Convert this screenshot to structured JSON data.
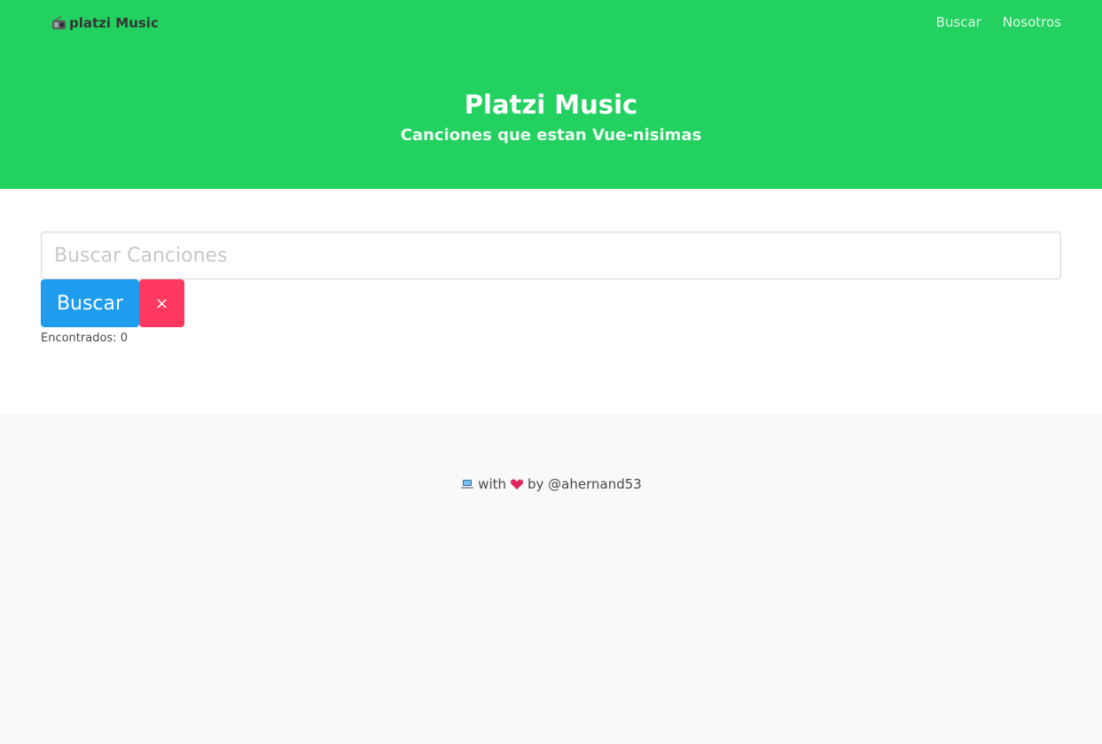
{
  "header": {
    "brand": {
      "icon": "radio-icon",
      "label": "platzi Music"
    },
    "nav": [
      {
        "label": "Buscar"
      },
      {
        "label": "Nosotros"
      }
    ],
    "title": "Platzi Music",
    "subtitle": "Canciones que estan Vue-nisimas"
  },
  "search": {
    "value": "",
    "placeholder": "Buscar Canciones",
    "search_button": "Buscar",
    "clear_button": "×",
    "results_text": "Encontrados: 0"
  },
  "footer": {
    "icon_1": "laptop-icon",
    "text_1": "with",
    "icon_2": "heart-icon",
    "text_2": "by @ahernand53"
  },
  "colors": {
    "hero": "#23d160",
    "primary_button": "#209cee",
    "danger_button": "#ff3860",
    "footer_bg": "#f9f9f9"
  }
}
